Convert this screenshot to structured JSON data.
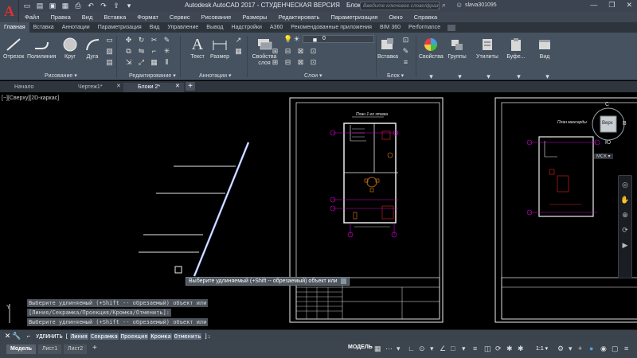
{
  "title": {
    "app": "Autodesk AutoCAD 2017 - СТУДЕНЧЕСКАЯ ВЕРСИЯ",
    "file": "Блоки 2.dwg"
  },
  "search": {
    "placeholder": "Введите ключевое слово/фразу"
  },
  "user": {
    "name": "slava301095"
  },
  "menu": [
    "Файл",
    "Правка",
    "Вид",
    "Вставка",
    "Формат",
    "Сервис",
    "Рисование",
    "Размеры",
    "Редактировать",
    "Параметризация",
    "Окно",
    "Справка"
  ],
  "ribbon_tabs": [
    "Главная",
    "Вставка",
    "Аннотации",
    "Параметризация",
    "Вид",
    "Управление",
    "Вывод",
    "Надстройки",
    "A360",
    "Рекомендованные приложения",
    "BIM 360",
    "Performance"
  ],
  "ribbon": {
    "draw_tools": [
      "Отрезок",
      "Полилиния",
      "Круг",
      "Дуга"
    ],
    "draw_panel": "Рисование",
    "modify_panel": "Редактирование",
    "annotation_tools": [
      "Текст",
      "Размер"
    ],
    "annotation_panel": "Аннотации",
    "layer_props": "Свойства слоя",
    "layers_panel": "Слои",
    "layer_current": "0",
    "insert": "Вставка",
    "block_panel": "Блок",
    "properties": "Свойства",
    "groups": "Группы",
    "utilities": "Утилиты",
    "clipboard": "Буфе...",
    "view": "Вид"
  },
  "doc_tabs": [
    "Начало",
    "Чертеж1*",
    "Блоки 2*"
  ],
  "viewport_label": "[−][Сверху][2D-каркас]",
  "drawing": {
    "sheet1_title": "План 1-го этажа",
    "sheet2_title": "План мансарды",
    "viewcube_label": "Верх",
    "compass_n": "С",
    "compass_e": "В",
    "compass_s": "Ю",
    "ucs_label": "МСК"
  },
  "prompt_tooltip": "Выберите удлиняемый (+Shift -- обрезаемый) объект или",
  "command_history": [
    "Выберите удлиняемый (+Shift -- обрезаемый) объект или",
    "[Линия/Секрамка/Проекция/Кромка/Отменить]:",
    "Выберите удлиняемый (+Shift -- обрезаемый) объект или"
  ],
  "command_line": {
    "name": "УДЛИНИТЬ",
    "options": [
      "Линия",
      "Секрамка",
      "Проекция",
      "Кромка",
      "Отменить"
    ],
    "suffix": "]:"
  },
  "layout_tabs": [
    "Модель",
    "Лист1",
    "Лист2"
  ],
  "status": {
    "model": "МОДЕЛЬ",
    "scale": "1:1"
  },
  "colors": {
    "accent": "#3c4550",
    "magenta": "#d000d0",
    "orange": "#e08020",
    "red": "#e02020",
    "selected_line": "#b8c8ff"
  }
}
